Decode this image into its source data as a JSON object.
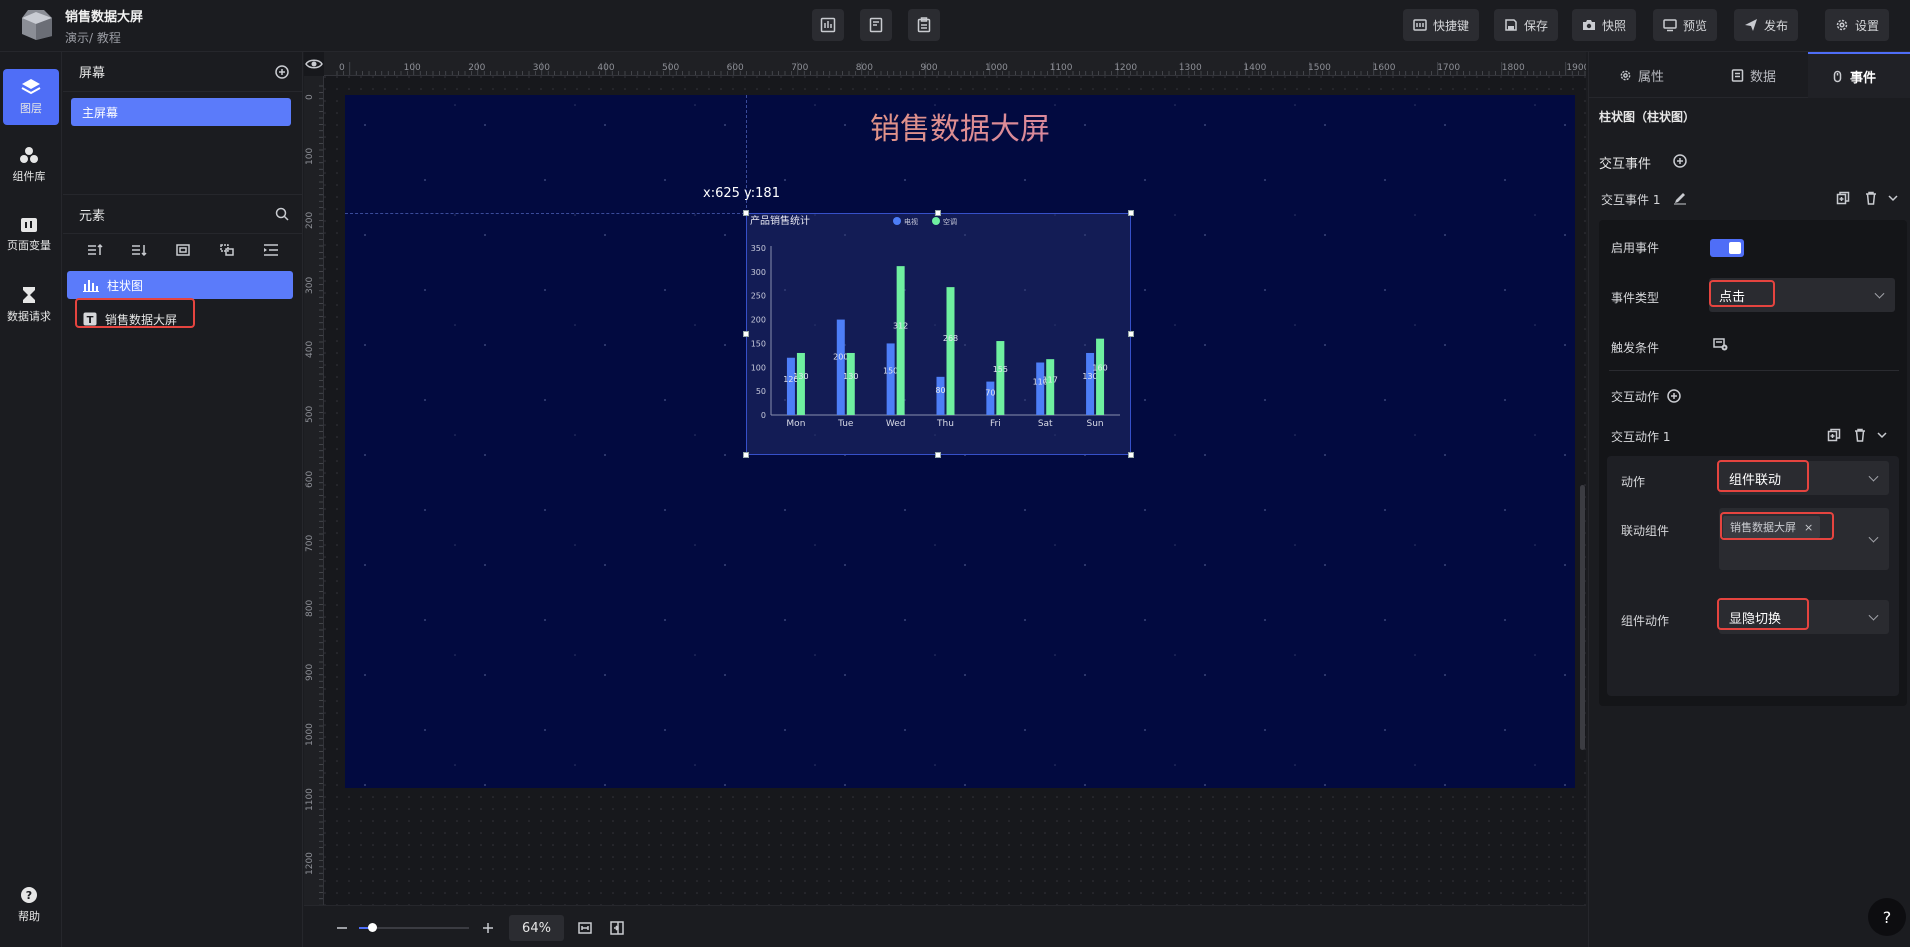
{
  "header": {
    "title": "销售数据大屏",
    "breadcrumb": "演示/ 教程",
    "buttons": {
      "shortcut": "快捷键",
      "save": "保存",
      "snapshot": "快照",
      "preview": "预览",
      "publish": "发布",
      "settings": "设置"
    }
  },
  "leftnav": {
    "items": [
      {
        "label": "图层"
      },
      {
        "label": "组件库"
      },
      {
        "label": "页面变量"
      },
      {
        "label": "数据请求"
      }
    ],
    "help": "帮助"
  },
  "layers": {
    "screens_title": "屏幕",
    "screen_item": "主屏幕",
    "elements_title": "元素",
    "elements": [
      {
        "label": "柱状图"
      },
      {
        "label": "销售数据大屏"
      }
    ]
  },
  "canvas": {
    "title": "销售数据大屏",
    "coord": "x:625 y:181",
    "ruler_top": [
      "0",
      "100",
      "200",
      "300",
      "400",
      "500",
      "600",
      "700",
      "800",
      "900",
      "1000",
      "1100",
      "1200",
      "1300",
      "1400",
      "1500",
      "1600",
      "1700",
      "1800",
      "1900"
    ],
    "ruler_left": [
      "0",
      "100",
      "200",
      "300",
      "400",
      "500",
      "600",
      "700",
      "800",
      "900",
      "1000",
      "1100",
      "1200"
    ]
  },
  "chart_data": {
    "type": "bar",
    "title": "产品销售统计",
    "categories": [
      "Mon",
      "Tue",
      "Wed",
      "Thu",
      "Fri",
      "Sat",
      "Sun"
    ],
    "series": [
      {
        "name": "电视",
        "color": "#4d7ef7",
        "values": [
          120,
          200,
          150,
          80,
          70,
          110,
          130
        ]
      },
      {
        "name": "空调",
        "color": "#6ff0a0",
        "values": [
          130,
          130,
          312,
          268,
          155,
          117,
          160
        ]
      }
    ],
    "yticks": [
      "0",
      "50",
      "100",
      "150",
      "200",
      "250",
      "300",
      "350"
    ],
    "ylim": [
      0,
      350
    ]
  },
  "zoom": {
    "value": "64%"
  },
  "props": {
    "tabs": [
      {
        "label": "属性"
      },
      {
        "label": "数据"
      },
      {
        "label": "事件"
      }
    ],
    "component_title": "柱状图（柱状图）",
    "interaction_events": "交互事件",
    "event_name": "交互事件 1",
    "enable_event": "启用事件",
    "event_type_label": "事件类型",
    "event_type_value": "点击",
    "trigger_condition": "触发条件",
    "interaction_actions": "交互动作",
    "action_name": "交互动作 1",
    "action_label": "动作",
    "action_value": "组件联动",
    "linked_component_label": "联动组件",
    "linked_component_tag": "销售数据大屏",
    "component_action_label": "组件动作",
    "component_action_value": "显隐切换"
  },
  "help_button": "?"
}
